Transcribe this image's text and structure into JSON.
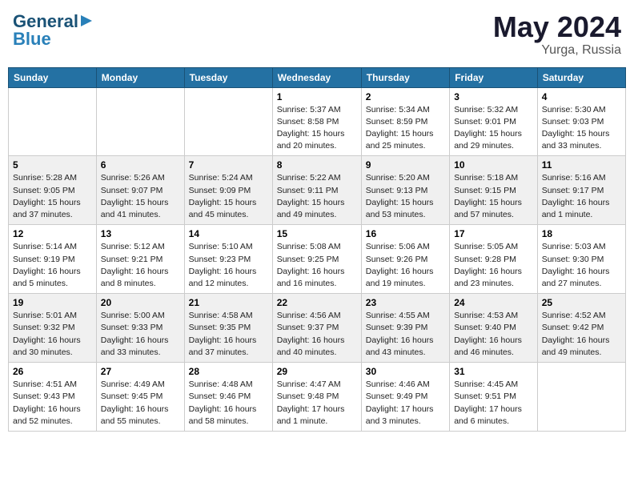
{
  "header": {
    "logo_general": "General",
    "logo_blue": "Blue",
    "month_year": "May 2024",
    "location": "Yurga, Russia"
  },
  "days_of_week": [
    "Sunday",
    "Monday",
    "Tuesday",
    "Wednesday",
    "Thursday",
    "Friday",
    "Saturday"
  ],
  "weeks": [
    [
      {
        "day": "",
        "info": ""
      },
      {
        "day": "",
        "info": ""
      },
      {
        "day": "",
        "info": ""
      },
      {
        "day": "1",
        "info": "Sunrise: 5:37 AM\nSunset: 8:58 PM\nDaylight: 15 hours\nand 20 minutes."
      },
      {
        "day": "2",
        "info": "Sunrise: 5:34 AM\nSunset: 8:59 PM\nDaylight: 15 hours\nand 25 minutes."
      },
      {
        "day": "3",
        "info": "Sunrise: 5:32 AM\nSunset: 9:01 PM\nDaylight: 15 hours\nand 29 minutes."
      },
      {
        "day": "4",
        "info": "Sunrise: 5:30 AM\nSunset: 9:03 PM\nDaylight: 15 hours\nand 33 minutes."
      }
    ],
    [
      {
        "day": "5",
        "info": "Sunrise: 5:28 AM\nSunset: 9:05 PM\nDaylight: 15 hours\nand 37 minutes."
      },
      {
        "day": "6",
        "info": "Sunrise: 5:26 AM\nSunset: 9:07 PM\nDaylight: 15 hours\nand 41 minutes."
      },
      {
        "day": "7",
        "info": "Sunrise: 5:24 AM\nSunset: 9:09 PM\nDaylight: 15 hours\nand 45 minutes."
      },
      {
        "day": "8",
        "info": "Sunrise: 5:22 AM\nSunset: 9:11 PM\nDaylight: 15 hours\nand 49 minutes."
      },
      {
        "day": "9",
        "info": "Sunrise: 5:20 AM\nSunset: 9:13 PM\nDaylight: 15 hours\nand 53 minutes."
      },
      {
        "day": "10",
        "info": "Sunrise: 5:18 AM\nSunset: 9:15 PM\nDaylight: 15 hours\nand 57 minutes."
      },
      {
        "day": "11",
        "info": "Sunrise: 5:16 AM\nSunset: 9:17 PM\nDaylight: 16 hours\nand 1 minute."
      }
    ],
    [
      {
        "day": "12",
        "info": "Sunrise: 5:14 AM\nSunset: 9:19 PM\nDaylight: 16 hours\nand 5 minutes."
      },
      {
        "day": "13",
        "info": "Sunrise: 5:12 AM\nSunset: 9:21 PM\nDaylight: 16 hours\nand 8 minutes."
      },
      {
        "day": "14",
        "info": "Sunrise: 5:10 AM\nSunset: 9:23 PM\nDaylight: 16 hours\nand 12 minutes."
      },
      {
        "day": "15",
        "info": "Sunrise: 5:08 AM\nSunset: 9:25 PM\nDaylight: 16 hours\nand 16 minutes."
      },
      {
        "day": "16",
        "info": "Sunrise: 5:06 AM\nSunset: 9:26 PM\nDaylight: 16 hours\nand 19 minutes."
      },
      {
        "day": "17",
        "info": "Sunrise: 5:05 AM\nSunset: 9:28 PM\nDaylight: 16 hours\nand 23 minutes."
      },
      {
        "day": "18",
        "info": "Sunrise: 5:03 AM\nSunset: 9:30 PM\nDaylight: 16 hours\nand 27 minutes."
      }
    ],
    [
      {
        "day": "19",
        "info": "Sunrise: 5:01 AM\nSunset: 9:32 PM\nDaylight: 16 hours\nand 30 minutes."
      },
      {
        "day": "20",
        "info": "Sunrise: 5:00 AM\nSunset: 9:33 PM\nDaylight: 16 hours\nand 33 minutes."
      },
      {
        "day": "21",
        "info": "Sunrise: 4:58 AM\nSunset: 9:35 PM\nDaylight: 16 hours\nand 37 minutes."
      },
      {
        "day": "22",
        "info": "Sunrise: 4:56 AM\nSunset: 9:37 PM\nDaylight: 16 hours\nand 40 minutes."
      },
      {
        "day": "23",
        "info": "Sunrise: 4:55 AM\nSunset: 9:39 PM\nDaylight: 16 hours\nand 43 minutes."
      },
      {
        "day": "24",
        "info": "Sunrise: 4:53 AM\nSunset: 9:40 PM\nDaylight: 16 hours\nand 46 minutes."
      },
      {
        "day": "25",
        "info": "Sunrise: 4:52 AM\nSunset: 9:42 PM\nDaylight: 16 hours\nand 49 minutes."
      }
    ],
    [
      {
        "day": "26",
        "info": "Sunrise: 4:51 AM\nSunset: 9:43 PM\nDaylight: 16 hours\nand 52 minutes."
      },
      {
        "day": "27",
        "info": "Sunrise: 4:49 AM\nSunset: 9:45 PM\nDaylight: 16 hours\nand 55 minutes."
      },
      {
        "day": "28",
        "info": "Sunrise: 4:48 AM\nSunset: 9:46 PM\nDaylight: 16 hours\nand 58 minutes."
      },
      {
        "day": "29",
        "info": "Sunrise: 4:47 AM\nSunset: 9:48 PM\nDaylight: 17 hours\nand 1 minute."
      },
      {
        "day": "30",
        "info": "Sunrise: 4:46 AM\nSunset: 9:49 PM\nDaylight: 17 hours\nand 3 minutes."
      },
      {
        "day": "31",
        "info": "Sunrise: 4:45 AM\nSunset: 9:51 PM\nDaylight: 17 hours\nand 6 minutes."
      },
      {
        "day": "",
        "info": ""
      }
    ]
  ]
}
